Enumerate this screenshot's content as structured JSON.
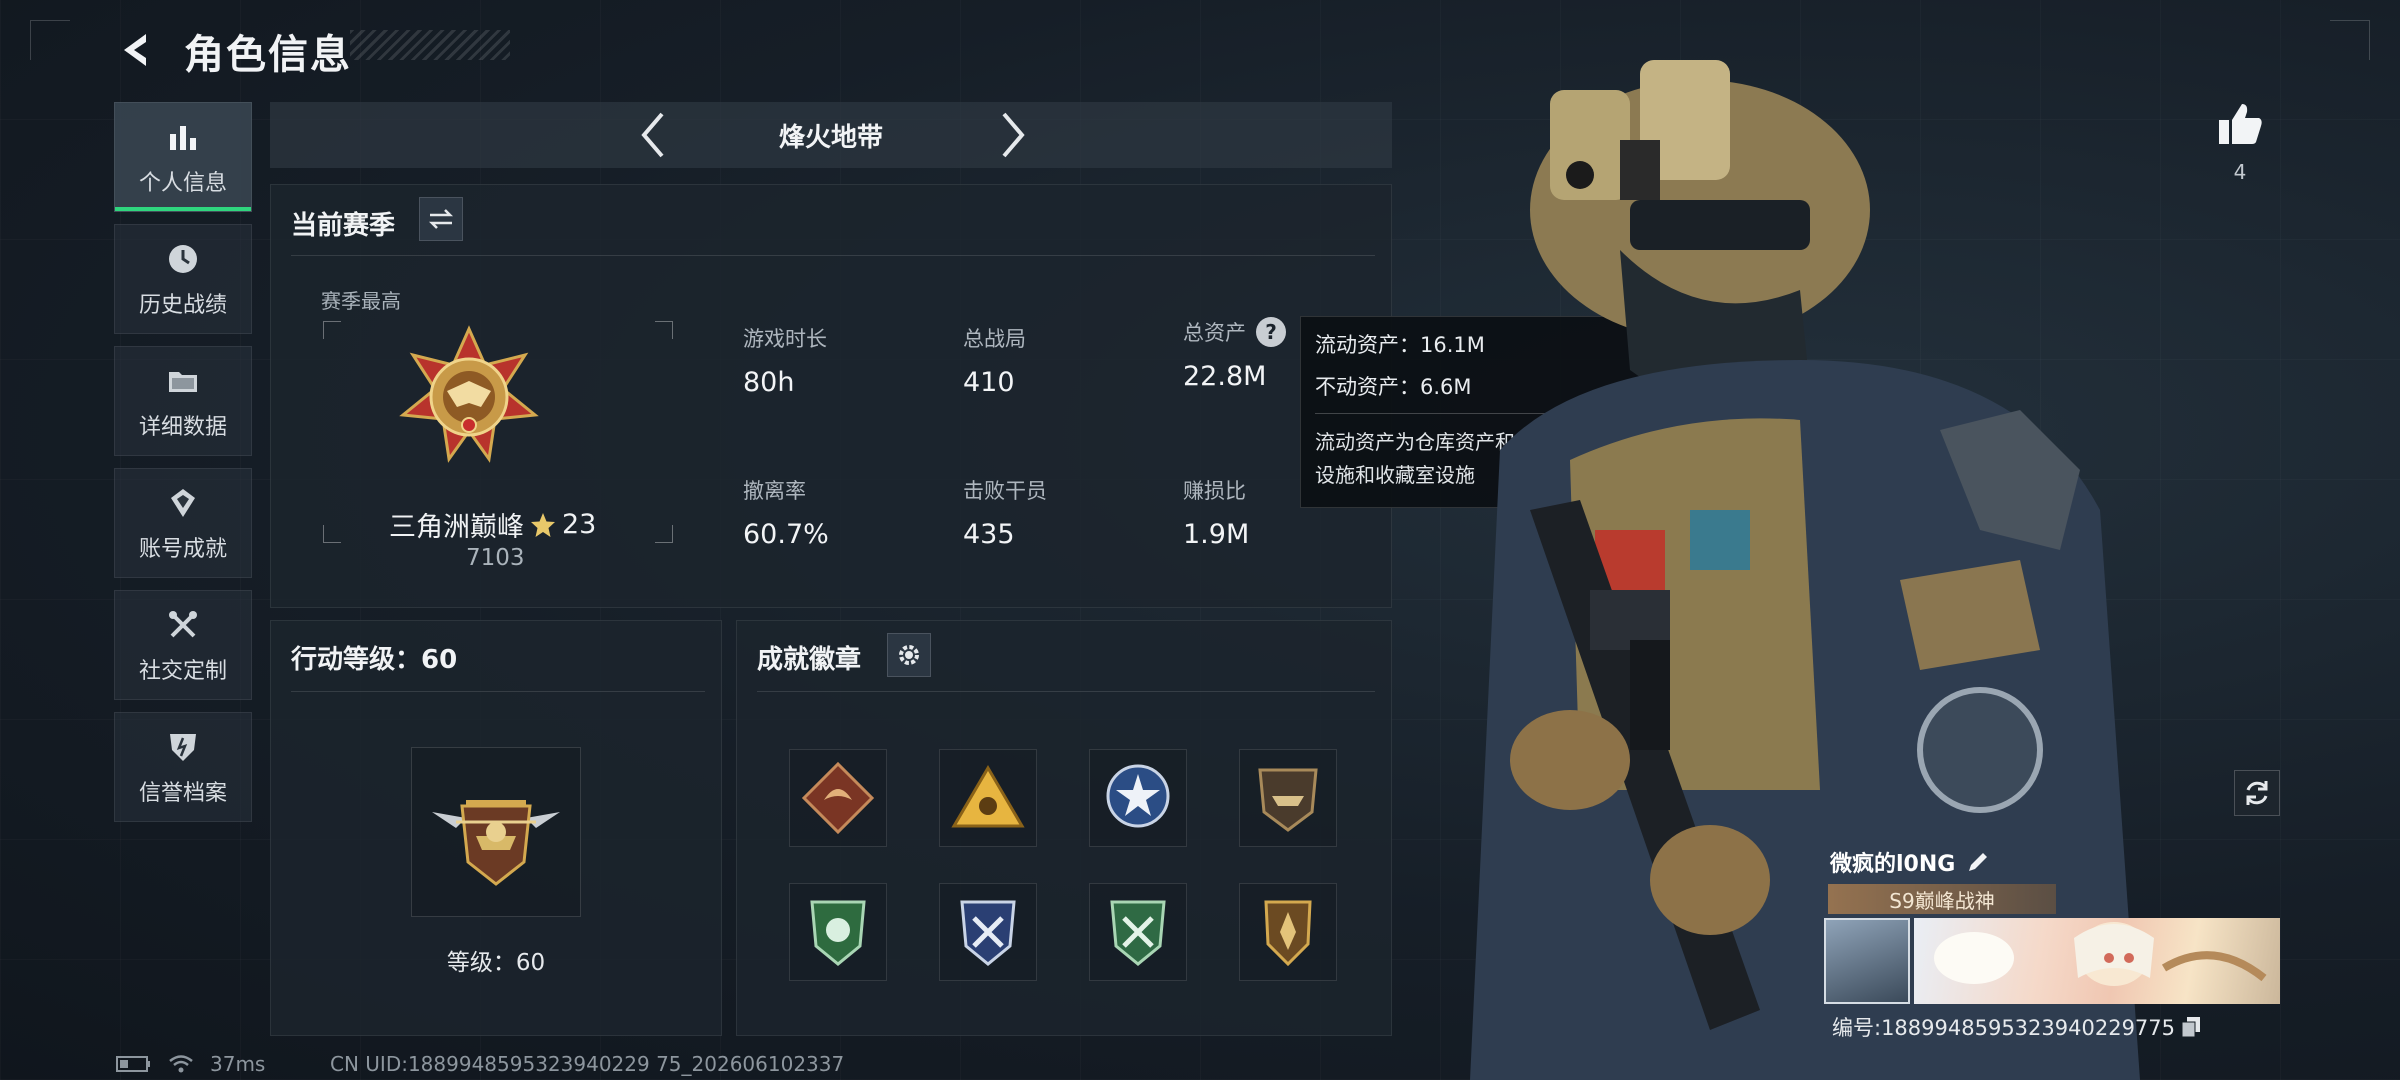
{
  "header": {
    "title": "角色信息"
  },
  "sidebar": {
    "items": [
      {
        "label": "个人信息",
        "icon": "bar-chart-icon",
        "active": true
      },
      {
        "label": "历史战绩",
        "icon": "clock-icon",
        "active": false
      },
      {
        "label": "详细数据",
        "icon": "folder-icon",
        "active": false
      },
      {
        "label": "账号成就",
        "icon": "achievement-icon",
        "active": false
      },
      {
        "label": "社交定制",
        "icon": "tools-icon",
        "active": false
      },
      {
        "label": "信誉档案",
        "icon": "shield-icon",
        "active": false
      }
    ]
  },
  "mode": {
    "title": "烽火地带"
  },
  "season": {
    "heading": "当前赛季",
    "best_label": "赛季最高",
    "rank_name": "三角洲巅峰",
    "rank_stars": "23",
    "rank_score": "7103",
    "stats": [
      {
        "label": "游戏时长",
        "value": "80h"
      },
      {
        "label": "总战局",
        "value": "410"
      },
      {
        "label": "总资产",
        "value": "22.8M"
      },
      {
        "label": "撤离率",
        "value": "60.7%"
      },
      {
        "label": "击败干员",
        "value": "435"
      },
      {
        "label": "赚损比",
        "value": "1.9M"
      }
    ]
  },
  "tooltip": {
    "liquid": "流动资产：16.1M",
    "fixed": "不动资产：6.6M",
    "desc": "流动资产为仓库资产和哈夫币，不动资产为特勤处设施和收藏室设施"
  },
  "action_level": {
    "heading": "行动等级：60",
    "level_text": "等级：60"
  },
  "badges": {
    "heading": "成就徽章"
  },
  "profile": {
    "like_count": "4",
    "player_name": "微疯的l0NG",
    "title_tag": "S9巅峰战神",
    "player_id": "编号:1889948595323940229775"
  },
  "status": {
    "ping": "37ms",
    "uid": "CN UID:1889948595323940229 75_202606102337"
  },
  "colors": {
    "accent": "#2fd67e",
    "background": "#141b23",
    "gold": "#d4a94f"
  }
}
